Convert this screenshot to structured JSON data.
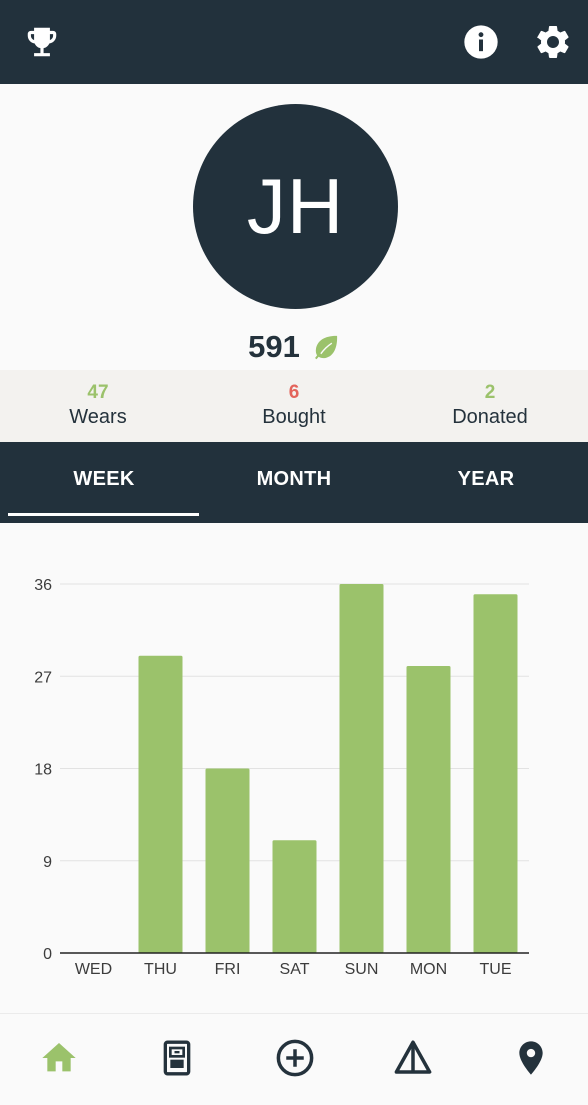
{
  "topbar": {
    "left_icon": "trophy-icon",
    "right_icons": [
      "info-icon",
      "gear-icon"
    ]
  },
  "profile": {
    "initials": "JH",
    "score": "591",
    "score_icon": "leaf-icon"
  },
  "stats": [
    {
      "value": "47",
      "label": "Wears",
      "color": "#9bc26b"
    },
    {
      "value": "6",
      "label": "Bought",
      "color": "#e3645b"
    },
    {
      "value": "2",
      "label": "Donated",
      "color": "#9bc26b"
    }
  ],
  "tabs": [
    {
      "label": "WEEK",
      "selected": true
    },
    {
      "label": "MONTH",
      "selected": false
    },
    {
      "label": "YEAR",
      "selected": false
    }
  ],
  "chart_data": {
    "type": "bar",
    "categories": [
      "WED",
      "THU",
      "FRI",
      "SAT",
      "SUN",
      "MON",
      "TUE"
    ],
    "values": [
      0,
      29,
      18,
      11,
      36,
      28,
      35
    ],
    "yticks": [
      "0",
      "9",
      "18",
      "27",
      "36"
    ],
    "ylim": [
      0,
      36
    ],
    "grid": true,
    "bar_color": "#9bc26b"
  },
  "bottom_nav": [
    {
      "icon": "home-icon",
      "active": true
    },
    {
      "icon": "wardrobe-icon",
      "active": false
    },
    {
      "icon": "add-circle-icon",
      "active": false
    },
    {
      "icon": "hanger-icon",
      "active": false
    },
    {
      "icon": "location-pin-icon",
      "active": false
    }
  ],
  "colors": {
    "dark": "#22313c",
    "accent_green": "#9bc26b",
    "accent_red": "#e3645b"
  }
}
